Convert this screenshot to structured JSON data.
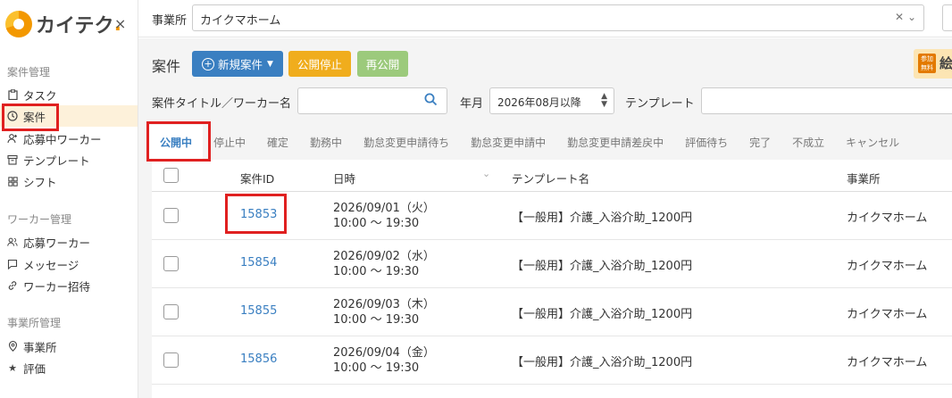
{
  "sidebar": {
    "logo_text": "カイテク",
    "close": "×",
    "sections": [
      {
        "title": "案件管理"
      },
      {
        "title": "ワーカー管理"
      },
      {
        "title": "事業所管理"
      }
    ],
    "items": [
      {
        "label": "タスク",
        "icon": "clipboard-icon"
      },
      {
        "label": "案件",
        "icon": "clock-icon"
      },
      {
        "label": "応募中ワーカー",
        "icon": "user-plus-icon"
      },
      {
        "label": "テンプレート",
        "icon": "archive-icon"
      },
      {
        "label": "シフト",
        "icon": "grid-icon"
      },
      {
        "label": "応募ワーカー",
        "icon": "users-icon"
      },
      {
        "label": "メッセージ",
        "icon": "message-icon"
      },
      {
        "label": "ワーカー招待",
        "icon": "link-icon"
      },
      {
        "label": "事業所",
        "icon": "location-icon"
      },
      {
        "label": "評価",
        "icon": "star-icon"
      }
    ]
  },
  "topbar": {
    "office_label": "事業所",
    "office_value": "カイクマホーム"
  },
  "main": {
    "title": "案件",
    "new_button": "新規案件",
    "stop_button": "公開停止",
    "republish_button": "再公開",
    "badge_small": "参加 無料",
    "badge_text": "絵",
    "filter_title_label": "案件タイトル／ワーカー名",
    "ym_label": "年月",
    "ym_value": "2026年08月以降",
    "template_label": "テンプレート",
    "tabs": [
      "公開中",
      "停止中",
      "確定",
      "勤務中",
      "勤怠変更申請待ち",
      "勤怠変更申請中",
      "勤怠変更申請差戻中",
      "評価待ち",
      "完了",
      "不成立",
      "キャンセル"
    ],
    "active_tab": "公開中"
  },
  "table": {
    "headers": {
      "id": "案件ID",
      "date": "日時",
      "template": "テンプレート名",
      "office": "事業所"
    },
    "rows": [
      {
        "id": "15853",
        "date": "2026/09/01（火）",
        "time": "10:00 〜 19:30",
        "template": "【一般用】介護_入浴介助_1200円",
        "office": "カイクマホーム"
      },
      {
        "id": "15854",
        "date": "2026/09/02（水）",
        "time": "10:00 〜 19:30",
        "template": "【一般用】介護_入浴介助_1200円",
        "office": "カイクマホーム"
      },
      {
        "id": "15855",
        "date": "2026/09/03（木）",
        "time": "10:00 〜 19:30",
        "template": "【一般用】介護_入浴介助_1200円",
        "office": "カイクマホーム"
      },
      {
        "id": "15856",
        "date": "2026/09/04（金）",
        "time": "10:00 〜 19:30",
        "template": "【一般用】介護_入浴介助_1200円",
        "office": "カイクマホーム"
      }
    ]
  },
  "colors": {
    "accent": "#3a7fc1",
    "highlight": "#e02020",
    "warning": "#f0ad1d",
    "success_light": "#9cca7c"
  }
}
